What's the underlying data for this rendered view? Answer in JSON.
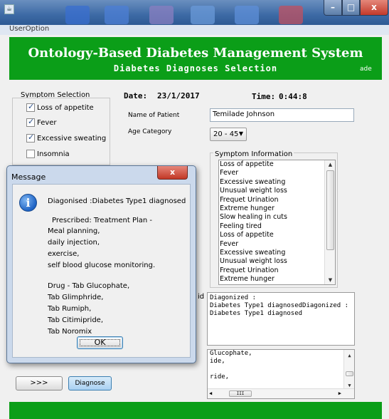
{
  "window": {
    "title_bar_tab": "UserOption",
    "minimize_icon": "minimize-icon",
    "maximize_icon": "maximize-icon",
    "close_icon": "close-icon"
  },
  "header": {
    "title": "Ontology-Based Diabetes Management System",
    "subtitle": "Diabetes Diagnoses Selection",
    "user": "ade",
    "color": "#0b9e18"
  },
  "symptom_selection": {
    "title": "Symptom Selection",
    "items": [
      {
        "label": "Loss of appetite",
        "checked": true
      },
      {
        "label": "Fever",
        "checked": true
      },
      {
        "label": "Excessive sweating",
        "checked": true
      },
      {
        "label": "Insomnia",
        "checked": false
      }
    ]
  },
  "date": {
    "label": "Date:",
    "value": "23/1/2017"
  },
  "time": {
    "label": "Time:",
    "value": "0:44:8"
  },
  "patient": {
    "name_label": "Name of Patient",
    "name_value": "Temilade Johnson"
  },
  "age": {
    "label": "Age Category",
    "selected": "20 - 45"
  },
  "symptom_info": {
    "title": "Symptom Information",
    "items": [
      "Loss of appetite",
      "Fever",
      "Excessive sweating",
      "Unusual weight loss",
      "Frequet Urination",
      "Extreme hunger",
      "Slow healing in cuts",
      "Feeling tired",
      "Loss of appetite",
      "Fever",
      "Excessive sweating",
      "Unusual weight loss",
      "Frequet Urination",
      "Extreme hunger"
    ]
  },
  "diagnosis_output": "Diagonized :\nDiabetes Type1 diagnosedDiagonized :\nDiabetes Type1 diagnosed",
  "drug_output": "Glucophate,\nide,\n\nride,",
  "buttons": {
    "next": ">>>",
    "diagnose": "Diagnose"
  },
  "dialog": {
    "title": "Message",
    "close": "x",
    "diagnosis": "Diagonised :Diabetes Type1 diagnosed",
    "prescribed": "Prescribed: Treatment Plan -",
    "plan": [
      "Meal planning,",
      "daily injection,",
      "exercise,",
      "self blood glucose monitoring."
    ],
    "drugs": [
      "Drug - Tab Glucophate,",
      "Tab Glimphride,",
      "Tab Rumiph,",
      "Tab Citimipride,",
      "Tab Noromix"
    ],
    "ok": "OK",
    "icon": "info-icon"
  },
  "fragment": "id"
}
